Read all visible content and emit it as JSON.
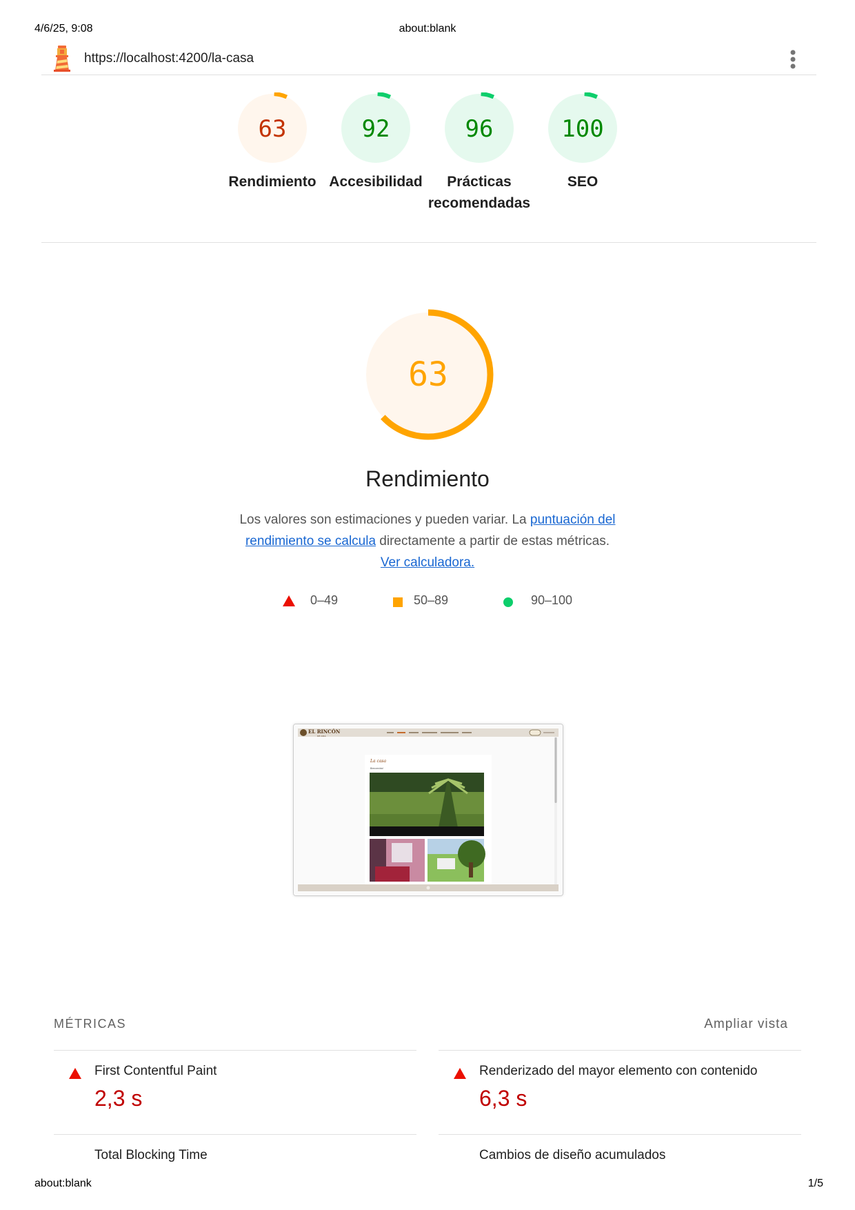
{
  "print_header": {
    "date": "4/6/25, 9:08",
    "title": "about:blank"
  },
  "print_footer": {
    "left": "about:blank",
    "right": "1/5"
  },
  "topbar": {
    "url": "https://localhost:4200/la-casa",
    "logo_icon": "lighthouse-icon",
    "menu_icon": "kebab-menu-icon"
  },
  "categories": [
    {
      "label": "Rendimiento",
      "score": "63",
      "value": 0.63,
      "status": "average"
    },
    {
      "label": "Accesibilidad",
      "score": "92",
      "value": 0.92,
      "status": "pass"
    },
    {
      "label": "Prácticas recomendadas",
      "score": "96",
      "value": 0.96,
      "status": "pass"
    },
    {
      "label": "SEO",
      "score": "100",
      "value": 1.0,
      "status": "pass"
    }
  ],
  "colors": {
    "average_ring": "#ffa400",
    "average_text": "#c33300",
    "average_fill": "#fff6ed",
    "big_score_text": "#ffa400",
    "pass_ring": "#0cce6b",
    "pass_text": "#008800",
    "pass_fill": "#e5f9ee",
    "fail": "#eb0f00",
    "link": "#1967d2"
  },
  "performance": {
    "score": "63",
    "value": 0.63,
    "title": "Rendimiento",
    "desc_part1": "Los valores son estimaciones y pueden variar. La ",
    "desc_link1": "puntuación del rendimiento se calcula",
    "desc_part2": " directamente a partir de estas métricas. ",
    "desc_link2": "Ver calculadora."
  },
  "legend": [
    {
      "range": "0–49",
      "status": "fail"
    },
    {
      "range": "50–89",
      "status": "average"
    },
    {
      "range": "90–100",
      "status": "pass"
    }
  ],
  "screenshot": {
    "site_name": "EL RINCÓN",
    "site_sub": "DE ANA",
    "page_heading": "La casa",
    "intro": "Bienvenido!"
  },
  "metrics": {
    "header": "MÉTRICAS",
    "expand_label": "Ampliar vista",
    "items": [
      {
        "title": "First Contentful Paint",
        "value": "2,3 s",
        "status": "fail"
      },
      {
        "title": "Renderizado del mayor elemento con contenido",
        "value": "6,3 s",
        "status": "fail"
      },
      {
        "title": "Total Blocking Time",
        "value": "",
        "status": ""
      },
      {
        "title": "Cambios de diseño acumulados",
        "value": "",
        "status": ""
      }
    ]
  }
}
